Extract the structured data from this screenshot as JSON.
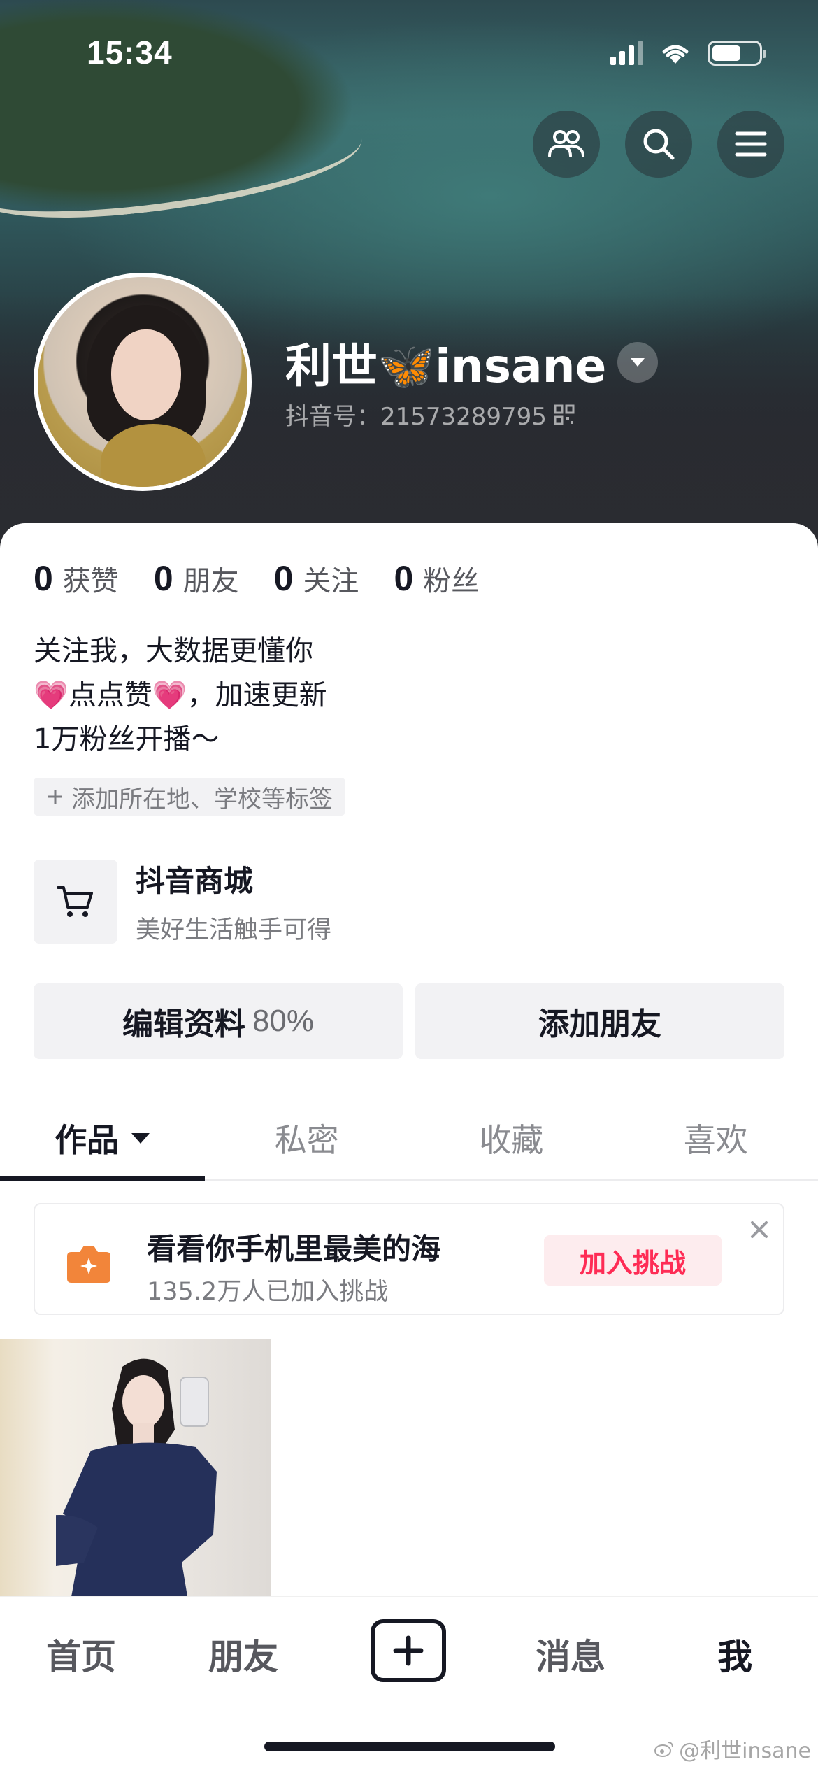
{
  "status_bar": {
    "time": "15:34"
  },
  "header": {
    "buttons": [
      {
        "icon": "friends-icon"
      },
      {
        "icon": "search-icon"
      },
      {
        "icon": "menu-icon"
      }
    ]
  },
  "profile": {
    "name": "利世🦋insane",
    "douyin_id": "抖音号：21573289795"
  },
  "stats": [
    {
      "value": "0",
      "label": "获赞"
    },
    {
      "value": "0",
      "label": "朋友"
    },
    {
      "value": "0",
      "label": "关注"
    },
    {
      "value": "0",
      "label": "粉丝"
    }
  ],
  "bio": {
    "line1": "关注我，大数据更懂你",
    "line2_heart_left": "💗",
    "line2_text": "点点赞",
    "line2_heart_right": "💗",
    "line2_end": "，加速更新",
    "line3": "1万粉丝开播～"
  },
  "tag_chip": {
    "label": "添加所在地、学校等标签"
  },
  "mall": {
    "title": "抖音商城",
    "subtitle": "美好生活触手可得"
  },
  "actions": {
    "edit_label": "编辑资料",
    "edit_percent": "80%",
    "add_friend_label": "添加朋友"
  },
  "tabs": [
    {
      "label": "作品",
      "active": true
    },
    {
      "label": "私密"
    },
    {
      "label": "收藏"
    },
    {
      "label": "喜欢"
    }
  ],
  "challenge": {
    "title": "看看你手机里最美的海",
    "subtitle": "135.2万人已加入挑战",
    "button": "加入挑战"
  },
  "bottom_nav": {
    "home": "首页",
    "friends": "朋友",
    "messages": "消息",
    "me": "我"
  },
  "watermark": "@利世insane",
  "colors": {
    "accent_red": "#fe2c55",
    "text_primary": "#161823",
    "challenge_icon": "#f2853a"
  }
}
